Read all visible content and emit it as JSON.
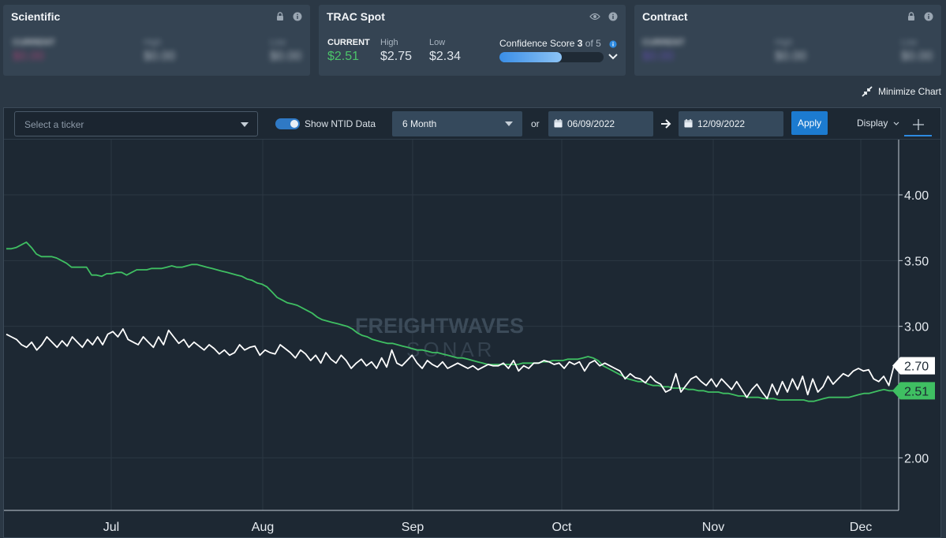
{
  "cards": {
    "scientific": {
      "title": "Scientific",
      "current_label": "CURRENT",
      "current": "$0.00",
      "high_label": "High",
      "high": "$0.00",
      "low_label": "Low",
      "low": "$0.00"
    },
    "trac": {
      "title": "TRAC Spot",
      "current_label": "CURRENT",
      "current": "$2.51",
      "high_label": "High",
      "high": "$2.75",
      "low_label": "Low",
      "low": "$2.34",
      "confidence_label": "Confidence Score",
      "confidence_value": "3",
      "confidence_of": "of 5",
      "confidence_fraction": 0.6
    },
    "contract": {
      "title": "Contract",
      "current_label": "CURRENT",
      "current": "$0.00",
      "high_label": "High",
      "high": "$0.00",
      "low_label": "Low",
      "low": "$0.00"
    }
  },
  "minimize_label": "Minimize Chart",
  "toolbar": {
    "ticker_placeholder": "Select a ticker",
    "ntid_label": "Show NTID Data",
    "ntid_on": true,
    "range": "6 Month",
    "or_label": "or",
    "start_date": "06/09/2022",
    "end_date": "12/09/2022",
    "apply_label": "Apply",
    "display_label": "Display"
  },
  "watermark": {
    "line1": "FREIGHTWAVES",
    "line2": "SONAR"
  },
  "colors": {
    "green": "#3fbf62",
    "white": "#ffffff",
    "accent": "#1c7bd0",
    "current_green": "#4cc46a"
  },
  "chart_data": {
    "type": "line",
    "x_labels": [
      "Jul",
      "Aug",
      "Sep",
      "Oct",
      "Nov",
      "Dec"
    ],
    "y_ticks": [
      "4.00",
      "3.50",
      "3.00",
      "2.00"
    ],
    "ylim": [
      1.6,
      4.42
    ],
    "grid": true,
    "series": [
      {
        "name": "",
        "color": "#3fbf62",
        "end_label": "2.51",
        "values": [
          3.59,
          3.59,
          3.6,
          3.62,
          3.64,
          3.6,
          3.55,
          3.53,
          3.53,
          3.53,
          3.52,
          3.5,
          3.48,
          3.45,
          3.45,
          3.45,
          3.45,
          3.39,
          3.39,
          3.38,
          3.4,
          3.4,
          3.41,
          3.41,
          3.39,
          3.41,
          3.43,
          3.43,
          3.43,
          3.44,
          3.44,
          3.44,
          3.45,
          3.46,
          3.45,
          3.45,
          3.46,
          3.47,
          3.47,
          3.46,
          3.45,
          3.44,
          3.43,
          3.42,
          3.41,
          3.4,
          3.39,
          3.38,
          3.36,
          3.35,
          3.33,
          3.32,
          3.3,
          3.26,
          3.22,
          3.2,
          3.18,
          3.17,
          3.16,
          3.14,
          3.12,
          3.1,
          3.07,
          3.05,
          3.04,
          3.03,
          3.02,
          3.01,
          3,
          2.98,
          2.95,
          2.93,
          2.92,
          2.9,
          2.89,
          2.88,
          2.87,
          2.87,
          2.86,
          2.85,
          2.84,
          2.83,
          2.82,
          2.82,
          2.81,
          2.8,
          2.8,
          2.79,
          2.78,
          2.77,
          2.76,
          2.76,
          2.75,
          2.74,
          2.73,
          2.72,
          2.71,
          2.71,
          2.71,
          2.71,
          2.71,
          2.71,
          2.71,
          2.72,
          2.72,
          2.72,
          2.72,
          2.73,
          2.73,
          2.74,
          2.74,
          2.74,
          2.75,
          2.75,
          2.75,
          2.76,
          2.77,
          2.76,
          2.74,
          2.7,
          2.68,
          2.66,
          2.64,
          2.62,
          2.6,
          2.59,
          2.58,
          2.58,
          2.56,
          2.55,
          2.55,
          2.54,
          2.54,
          2.53,
          2.53,
          2.53,
          2.52,
          2.52,
          2.51,
          2.51,
          2.5,
          2.5,
          2.5,
          2.49,
          2.49,
          2.48,
          2.47,
          2.47,
          2.46,
          2.46,
          2.46,
          2.45,
          2.45,
          2.45,
          2.44,
          2.44,
          2.44,
          2.44,
          2.44,
          2.44,
          2.43,
          2.43,
          2.44,
          2.45,
          2.46,
          2.46,
          2.46,
          2.46,
          2.46,
          2.47,
          2.48,
          2.49,
          2.49,
          2.5,
          2.51,
          2.52,
          2.51,
          2.51
        ]
      },
      {
        "name": "",
        "color": "#ffffff",
        "end_label": "2.70",
        "values": [
          2.94,
          2.92,
          2.9,
          2.86,
          2.84,
          2.88,
          2.82,
          2.86,
          2.92,
          2.88,
          2.84,
          2.89,
          2.85,
          2.92,
          2.88,
          2.84,
          2.9,
          2.86,
          2.92,
          2.86,
          2.94,
          2.96,
          2.92,
          2.98,
          2.9,
          2.88,
          2.86,
          2.92,
          2.88,
          2.84,
          2.92,
          2.86,
          2.97,
          2.92,
          2.87,
          2.9,
          2.84,
          2.88,
          2.85,
          2.82,
          2.86,
          2.83,
          2.79,
          2.82,
          2.78,
          2.8,
          2.86,
          2.82,
          2.84,
          2.85,
          2.78,
          2.82,
          2.8,
          2.79,
          2.86,
          2.83,
          2.8,
          2.76,
          2.82,
          2.79,
          2.74,
          2.78,
          2.72,
          2.8,
          2.75,
          2.72,
          2.78,
          2.74,
          2.68,
          2.72,
          2.75,
          2.7,
          2.73,
          2.68,
          2.76,
          2.69,
          2.82,
          2.72,
          2.7,
          2.74,
          2.78,
          2.72,
          2.68,
          2.74,
          2.71,
          2.69,
          2.73,
          2.68,
          2.7,
          2.72,
          2.7,
          2.68,
          2.7,
          2.67,
          2.69,
          2.71,
          2.7,
          2.7,
          2.72,
          2.68,
          2.74,
          2.66,
          2.7,
          2.68,
          2.72,
          2.72,
          2.74,
          2.73,
          2.71,
          2.72,
          2.68,
          2.73,
          2.71,
          2.73,
          2.66,
          2.72,
          2.74,
          2.7,
          2.72,
          2.7,
          2.68,
          2.66,
          2.6,
          2.64,
          2.61,
          2.6,
          2.57,
          2.62,
          2.58,
          2.56,
          2.5,
          2.52,
          2.64,
          2.5,
          2.55,
          2.6,
          2.62,
          2.58,
          2.55,
          2.6,
          2.54,
          2.6,
          2.56,
          2.52,
          2.58,
          2.52,
          2.46,
          2.52,
          2.56,
          2.5,
          2.45,
          2.56,
          2.48,
          2.58,
          2.5,
          2.6,
          2.52,
          2.62,
          2.48,
          2.6,
          2.5,
          2.54,
          2.62,
          2.56,
          2.6,
          2.64,
          2.62,
          2.66,
          2.68,
          2.66,
          2.67,
          2.6,
          2.58,
          2.62,
          2.55,
          2.7
        ]
      }
    ]
  }
}
